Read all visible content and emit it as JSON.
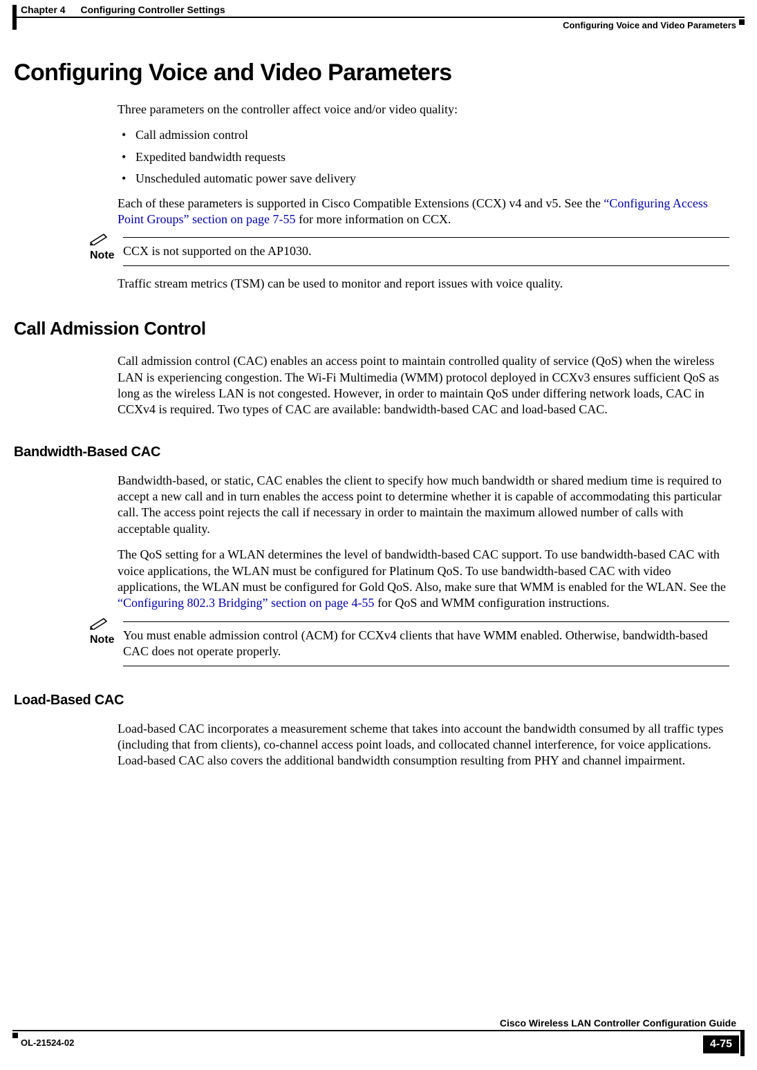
{
  "header": {
    "chapter_label": "Chapter 4",
    "chapter_title": "Configuring Controller Settings",
    "section_right": "Configuring Voice and Video Parameters"
  },
  "h1": "Configuring Voice and Video Parameters",
  "intro": {
    "p1": "Three parameters on the controller affect voice and/or video quality:",
    "bullets": [
      "Call admission control",
      "Expedited bandwidth requests",
      "Unscheduled automatic power save delivery"
    ],
    "p2a": "Each of these parameters is supported in Cisco Compatible Extensions (CCX) v4 and v5. See the ",
    "p2_link": "“Configuring Access Point Groups” section on page 7-55",
    "p2b": " for more information on CCX."
  },
  "note1": {
    "label": "Note",
    "text": "CCX is not supported on the AP1030."
  },
  "intro2": {
    "p1": "Traffic stream metrics (TSM) can be used to monitor and report issues with voice quality."
  },
  "cac": {
    "heading": "Call Admission Control",
    "p1": "Call admission control (CAC) enables an access point to maintain controlled quality of service (QoS) when the wireless LAN is experiencing congestion. The Wi-Fi Multimedia (WMM) protocol deployed in CCXv3 ensures sufficient QoS as long as the wireless LAN is not congested. However, in order to maintain QoS under differing network loads, CAC in CCXv4 is required. Two types of CAC are available: bandwidth-based CAC and load-based CAC."
  },
  "bw": {
    "heading": "Bandwidth-Based CAC",
    "p1": "Bandwidth-based, or static, CAC enables the client to specify how much bandwidth or shared medium time is required to accept a new call and in turn enables the access point to determine whether it is capable of accommodating this particular call. The access point rejects the call if necessary in order to maintain the maximum allowed number of calls with acceptable quality.",
    "p2a": "The QoS setting for a WLAN determines the level of bandwidth-based CAC support. To use bandwidth-based CAC with voice applications, the WLAN must be configured for Platinum QoS. To use bandwidth-based CAC with video applications, the WLAN must be configured for Gold QoS. Also, make sure that WMM is enabled for the WLAN. See the ",
    "p2_link": "“Configuring 802.3 Bridging” section on page 4-55",
    "p2b": " for QoS and WMM configuration instructions."
  },
  "note2": {
    "label": "Note",
    "text": "You must enable admission control (ACM) for CCXv4 clients that have WMM enabled. Otherwise, bandwidth-based CAC does not operate properly."
  },
  "load": {
    "heading": "Load-Based CAC",
    "p1": "Load-based CAC incorporates a measurement scheme that takes into account the bandwidth consumed by all traffic types (including that from clients), co-channel access point loads, and collocated channel interference, for voice applications. Load-based CAC also covers the additional bandwidth consumption resulting from PHY and channel impairment."
  },
  "footer": {
    "book_title": "Cisco Wireless LAN Controller Configuration Guide",
    "doc_id": "OL-21524-02",
    "page_number": "4-75"
  }
}
